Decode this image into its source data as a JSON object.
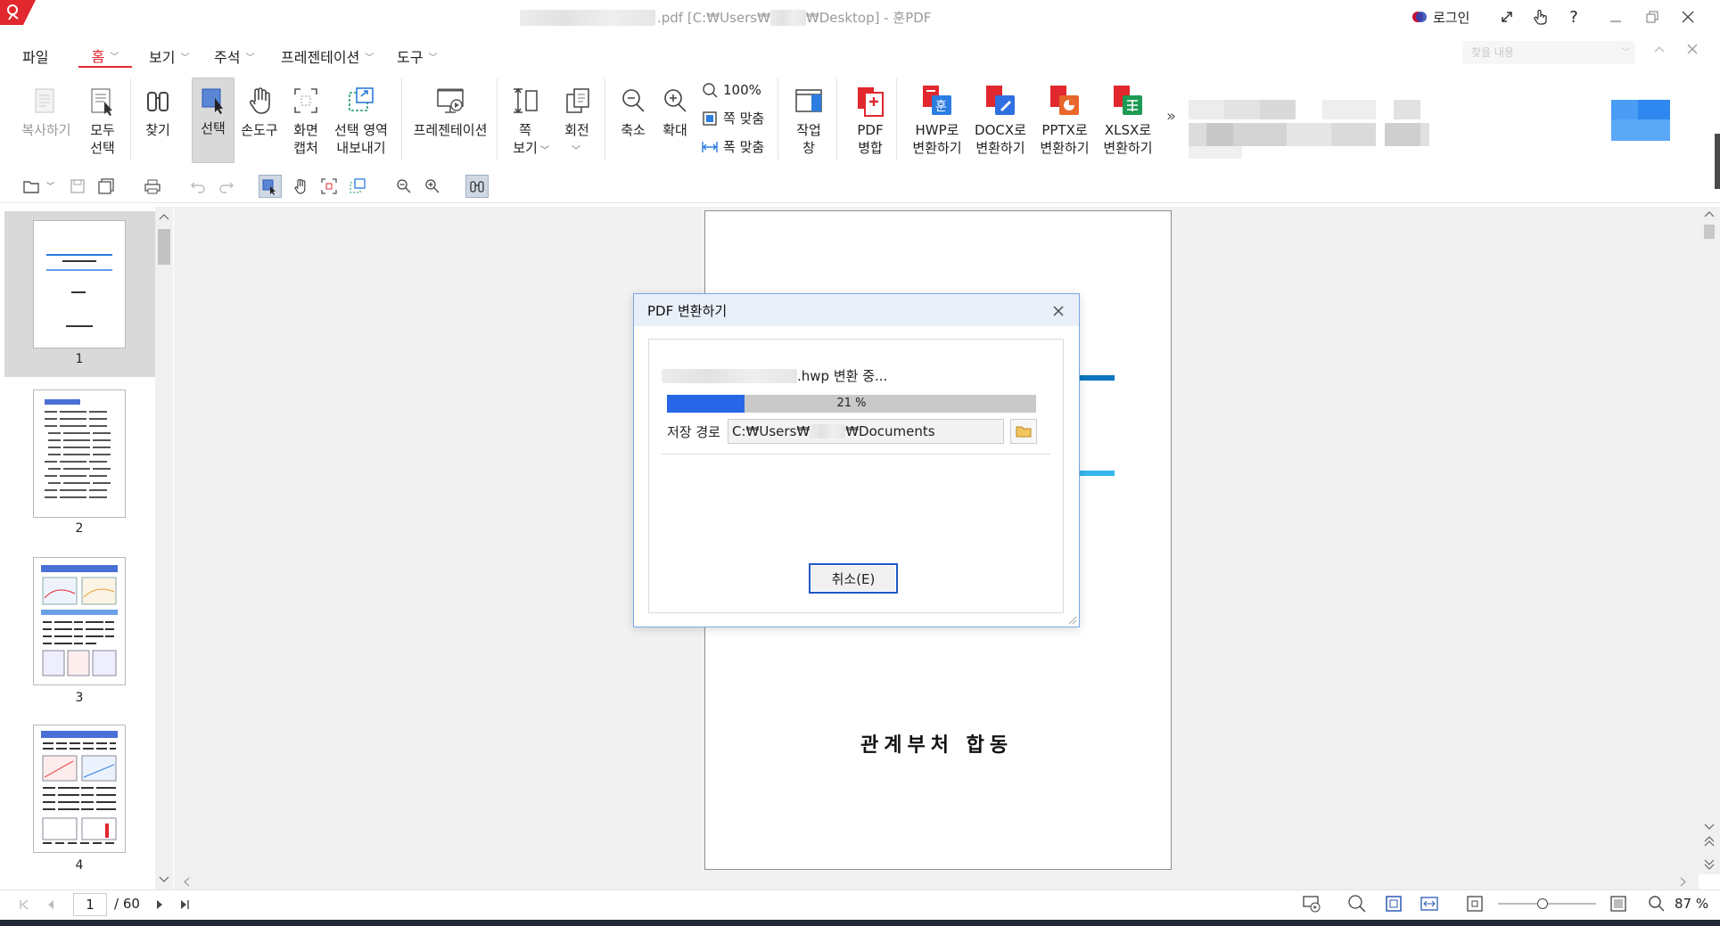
{
  "window": {
    "title_ext": ".pdf [C:₩Users₩",
    "title_desktop": "₩Desktop] - 훈PDF",
    "login_label": "로그인",
    "help_label": "?"
  },
  "menu": {
    "file": "파일",
    "tabs": [
      {
        "label": "홈"
      },
      {
        "label": "보기"
      },
      {
        "label": "주석"
      },
      {
        "label": "프레젠테이션"
      },
      {
        "label": "도구"
      }
    ],
    "search_placeholder": "찾을 내용"
  },
  "ribbon": {
    "copy": "복사하기",
    "select_all": "모두\n선택",
    "find": "찾기",
    "select": "선택",
    "hand": "손도구",
    "capture": "화면\n캡처",
    "export_area": "선택 영역\n내보내기",
    "presentation": "프레젠테이션",
    "page_view": "쪽\n보기",
    "rotate": "회전",
    "zoom_out": "축소",
    "zoom_in": "확대",
    "zoom_100": "100%",
    "fit_page": "쪽 맞춤",
    "fit_width": "폭 맞춤",
    "work_window": "작업\n창",
    "pdf_merge": "PDF\n병합",
    "to_hwp": "HWP로\n변환하기",
    "to_docx": "DOCX로\n변환하기",
    "to_pptx": "PPTX로\n변환하기",
    "to_xlsx": "XLSX로\n변환하기",
    "more": "»"
  },
  "thumbnails": [
    {
      "page": "1"
    },
    {
      "page": "2"
    },
    {
      "page": "3"
    },
    {
      "page": "4"
    }
  ],
  "document": {
    "footer_text": "관계부처 합동"
  },
  "status": {
    "current_page": "1",
    "total_pages": "/ 60",
    "zoom_percent": "87 %",
    "zoom_slider_value": 0.45
  },
  "dialog": {
    "title": "PDF 변환하기",
    "converting_text": ".hwp 변환 중...",
    "progress_value": 0.21,
    "progress_label": "21 %",
    "save_path_label": "저장 경로",
    "save_path_prefix": "C:₩Users₩",
    "save_path_suffix": "₩Documents",
    "cancel_label": "취소(E)"
  },
  "colors": {
    "brand": "#e0282e",
    "progress_fill": "#2766e6",
    "dialog_header": "#e9eff9",
    "hwp_icon": "#e0282e",
    "docx_icon": "#2f6fe0",
    "pptx_icon": "#e8662a",
    "xlsx_icon": "#1d9a54"
  }
}
